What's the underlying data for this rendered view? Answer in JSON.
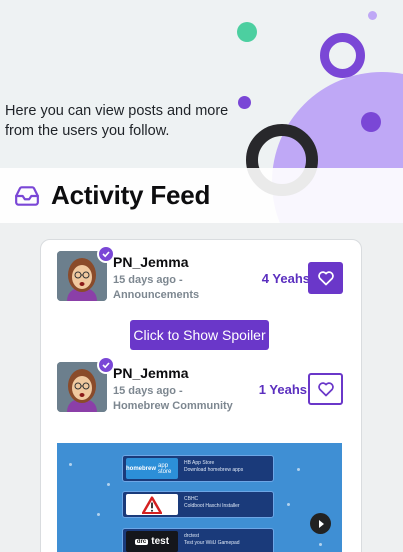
{
  "hero": {
    "subtitle": "Here you can view posts and more from the users you follow."
  },
  "header": {
    "title": "Activity Feed",
    "icon": "inbox-icon"
  },
  "posts": [
    {
      "username": "PN_Jemma",
      "time": "15 days ago -",
      "community": "Announcements",
      "yeahs": "4 Yeahs",
      "yeahed": true
    },
    {
      "username": "PN_Jemma",
      "time": "15 days ago -",
      "community": "Homebrew Community",
      "yeahs": "1 Yeahs",
      "yeahed": false
    }
  ],
  "spoiler_button": "Click to Show Spoiler",
  "post_image": {
    "apps": [
      {
        "logo_main": "homebrew",
        "logo_sub": "app store",
        "name": "HB App Store",
        "desc": "Download homebrew apps"
      },
      {
        "logo_main": "",
        "logo_sub": "",
        "name": "CBHC",
        "desc": "Coldboot Haxchi Installer"
      },
      {
        "logo_main": "drc",
        "logo_sub": "test",
        "name": "drctest",
        "desc": "Test your WiiU Gamepad"
      }
    ]
  },
  "colors": {
    "accent": "#6a37c9",
    "accent_light": "#bfa8f6",
    "green": "#4ccfa0",
    "dark": "#28282b"
  }
}
